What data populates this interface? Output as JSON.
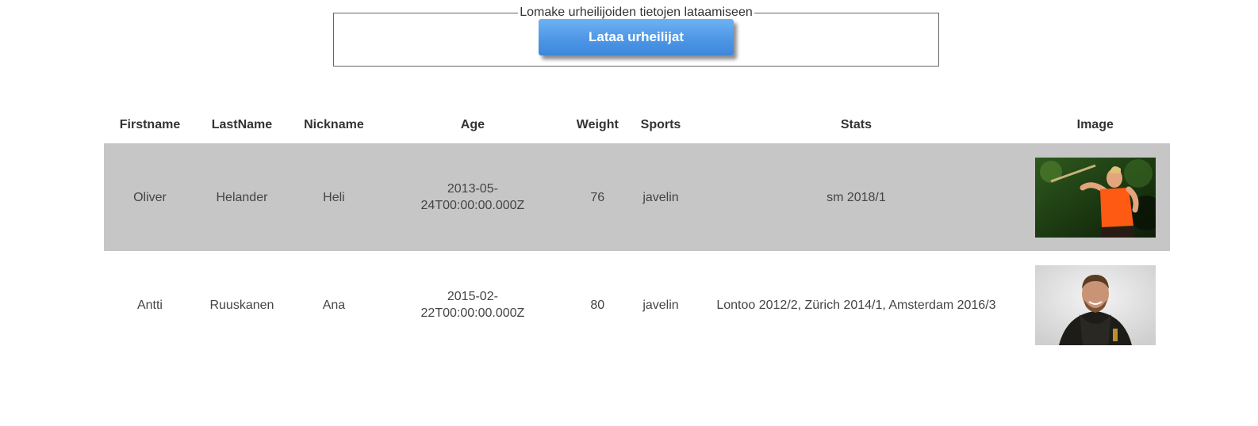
{
  "form": {
    "legend": "Lomake urheilijoiden tietojen lataamiseen",
    "button_label": "Lataa urheilijat"
  },
  "table": {
    "headers": {
      "firstname": "Firstname",
      "lastname": "LastName",
      "nickname": "Nickname",
      "age": "Age",
      "weight": "Weight",
      "sports": "Sports",
      "stats": "Stats",
      "image": "Image"
    },
    "rows": [
      {
        "firstname": "Oliver",
        "lastname": "Helander",
        "nickname": "Heli",
        "age_line1": "2013-05-",
        "age_line2": "24T00:00:00.000Z",
        "weight": "76",
        "sports": "javelin",
        "stats": "sm 2018/1",
        "image_icon": "athlete-photo-icon"
      },
      {
        "firstname": "Antti",
        "lastname": "Ruuskanen",
        "nickname": "Ana",
        "age_line1": "2015-02-",
        "age_line2": "22T00:00:00.000Z",
        "weight": "80",
        "sports": "javelin",
        "stats": "Lontoo 2012/2, Zürich 2014/1, Amsterdam 2016/3",
        "image_icon": "athlete-portrait-icon"
      }
    ]
  },
  "colors": {
    "row_shade": "#c6c6c6",
    "button_blue": "#4e97e6"
  }
}
